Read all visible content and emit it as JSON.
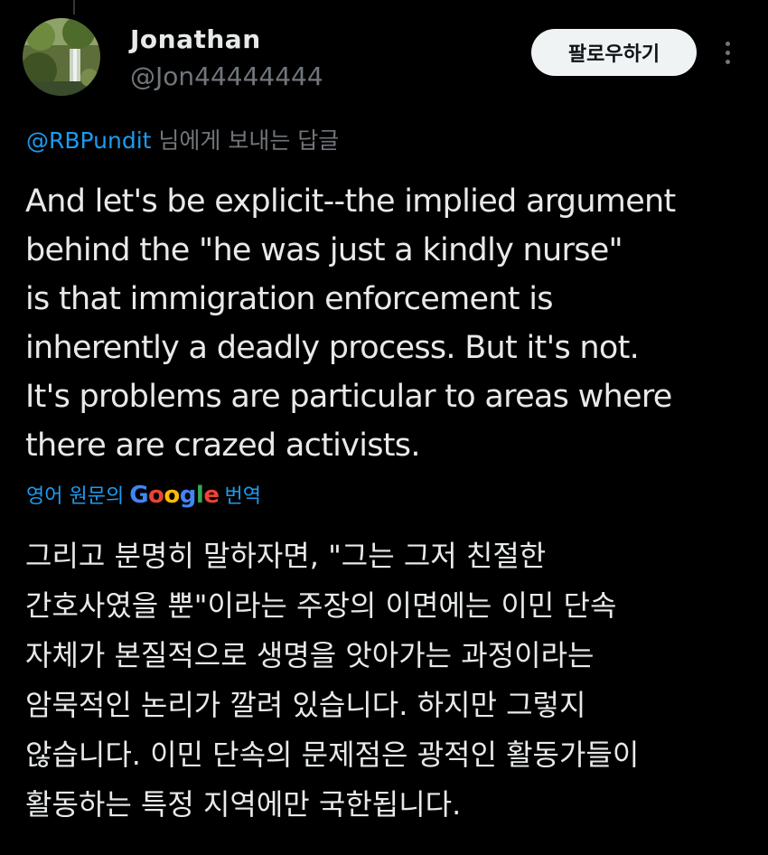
{
  "author": {
    "display_name": "Jonathan",
    "handle": "@Jon44444444",
    "avatar": "landscape-photo-avatar"
  },
  "follow_button_label": "팔로우하기",
  "more_icon": "more-vertical-icon",
  "reply_context": {
    "mention": "@RBPundit",
    "suffix": " 님에게 보내는 답글"
  },
  "tweet_text": "And let's be explicit--the implied argument\nbehind the \"he was just a kindly nurse\"\nis that immigration enforcement is\ninherently a deadly process.  But it's not.\nIt's problems are particular to areas where\nthere are crazed activists.",
  "translation": {
    "label": "영어 원문의",
    "provider": "Google",
    "suffix": "번역",
    "text": "그리고 분명히 말하자면, \"그는 그저 친절한\n간호사였을 뿐\"이라는 주장의 이면에는 이민 단속\n자체가 본질적으로 생명을 앗아가는 과정이라는\n암묵적인 논리가 깔려 있습니다. 하지만 그렇지\n않습니다. 이민 단속의 문제점은 광적인 활동가들이\n활동하는 특정 지역에만 국한됩니다."
  },
  "colors": {
    "background": "#000000",
    "text": "#e7e9ea",
    "secondary": "#71767b",
    "link": "#1d9bf0"
  }
}
